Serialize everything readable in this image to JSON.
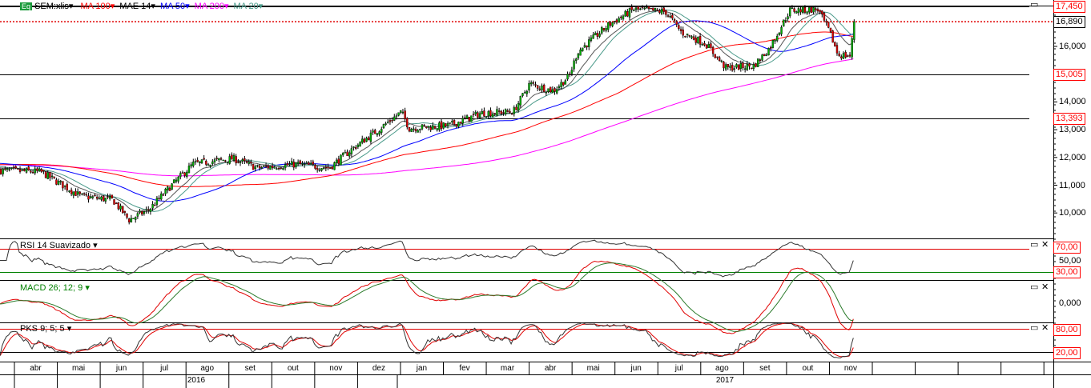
{
  "legend": {
    "symbol": "SEM:xlis",
    "icon": "eq-icon",
    "icon_text": "Eq",
    "items": [
      {
        "label": "MA 100",
        "color": "#ff0000"
      },
      {
        "label": "MAE 14",
        "color": "#000000"
      },
      {
        "label": "MA 50",
        "color": "#0000ff"
      },
      {
        "label": "MA 200",
        "color": "#ff00ff"
      },
      {
        "label": "MA 20",
        "color": "#4a9a8a"
      }
    ]
  },
  "price_axis": {
    "ticks": [
      "16,000",
      "14,000",
      "13,000",
      "12,000",
      "11,000",
      "10,000"
    ],
    "tick_values": [
      16000,
      14000,
      13000,
      12000,
      11000,
      10000
    ],
    "levels": [
      {
        "label": "17,450",
        "value": 17450
      },
      {
        "label": "15,005",
        "value": 15005
      },
      {
        "label": "13,393",
        "value": 13393
      }
    ],
    "last": {
      "label": "16,890",
      "value": 16890
    }
  },
  "rsi": {
    "title": "RSI 14 Suavizado",
    "upper": "70,00",
    "mid": "50,00",
    "lower": "30,00"
  },
  "macd": {
    "title": "MACD 26; 12; 9",
    "zero": "0,000"
  },
  "pks": {
    "title": "PKS 9; 5; 5",
    "upper": "80,00",
    "lower": "20,00"
  },
  "time_axis": {
    "months": [
      "abr",
      "mai",
      "jun",
      "jul",
      "ago",
      "set",
      "out",
      "nov",
      "dez",
      "jan",
      "fev",
      "mar",
      "abr",
      "mai",
      "jun",
      "jul",
      "ago",
      "set",
      "out",
      "nov",
      "",
      "",
      "",
      "",
      ""
    ],
    "years": [
      "2016",
      "2017"
    ]
  },
  "chart_data": {
    "type": "candlestick",
    "title": "SEM:xlis",
    "price_anchors": [
      [
        0,
        11530
      ],
      [
        50,
        11480
      ],
      [
        100,
        10600
      ],
      [
        140,
        10470
      ],
      [
        160,
        9750
      ],
      [
        185,
        10120
      ],
      [
        210,
        10900
      ],
      [
        240,
        11760
      ],
      [
        290,
        11960
      ],
      [
        320,
        11620
      ],
      [
        370,
        11760
      ],
      [
        410,
        11620
      ],
      [
        440,
        12340
      ],
      [
        470,
        12970
      ],
      [
        500,
        13640
      ],
      [
        510,
        13050
      ],
      [
        560,
        13150
      ],
      [
        600,
        13600
      ],
      [
        640,
        13650
      ],
      [
        660,
        14650
      ],
      [
        690,
        14400
      ],
      [
        710,
        14950
      ],
      [
        720,
        15800
      ],
      [
        760,
        16800
      ],
      [
        790,
        17330
      ],
      [
        830,
        17250
      ],
      [
        850,
        16500
      ],
      [
        880,
        16100
      ],
      [
        905,
        15220
      ],
      [
        940,
        15300
      ],
      [
        960,
        15950
      ],
      [
        985,
        17300
      ],
      [
        1020,
        17330
      ],
      [
        1035,
        16500
      ],
      [
        1045,
        15700
      ],
      [
        1060,
        15650
      ],
      [
        1066,
        16890
      ]
    ],
    "ylim": [
      9200,
      17650
    ],
    "colors": {
      "up": "#00b000",
      "down": "#e00000"
    }
  }
}
